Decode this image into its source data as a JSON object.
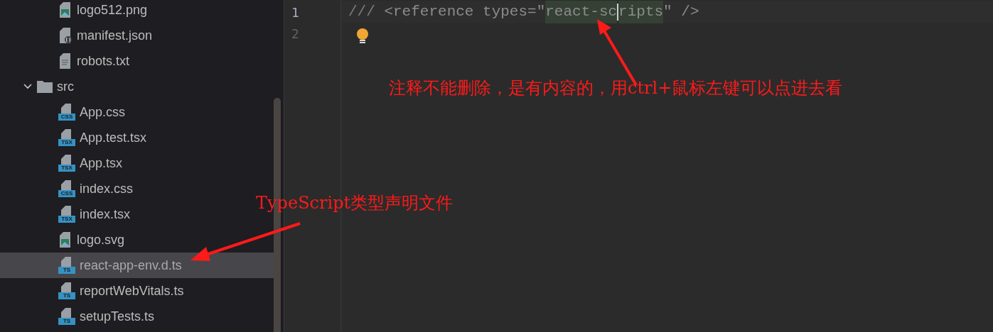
{
  "tree": [
    {
      "children": [
        {
          "kind": "image",
          "label": "logo512.png",
          "selected": false
        },
        {
          "kind": "json",
          "label": "manifest.json",
          "selected": false
        },
        {
          "kind": "text",
          "label": "robots.txt",
          "selected": false
        }
      ]
    },
    {
      "kind": "folder",
      "label": "src",
      "expanded": true,
      "selected": false,
      "children": [
        {
          "kind": "badge",
          "badge": "CSS",
          "label": "App.css",
          "selected": false
        },
        {
          "kind": "badge",
          "badge": "TSX",
          "label": "App.test.tsx",
          "selected": false
        },
        {
          "kind": "badge",
          "badge": "TSX",
          "label": "App.tsx",
          "selected": false
        },
        {
          "kind": "badge",
          "badge": "CSS",
          "label": "index.css",
          "selected": false
        },
        {
          "kind": "badge",
          "badge": "TSX",
          "label": "index.tsx",
          "selected": false
        },
        {
          "kind": "image",
          "label": "logo.svg",
          "selected": false
        },
        {
          "kind": "badge",
          "badge": "TS",
          "label": "react-app-env.d.ts",
          "selected": true
        },
        {
          "kind": "badge",
          "badge": "TS",
          "label": "reportWebVitals.ts",
          "selected": false
        },
        {
          "kind": "badge",
          "badge": "TS",
          "label": "setupTests.ts",
          "selected": false
        }
      ]
    }
  ],
  "editor": {
    "lines": [
      {
        "number": "1",
        "current": true,
        "tokens": [
          {
            "kind": "comment",
            "text": "///"
          },
          {
            "kind": "plain",
            "text": " <reference types=\""
          },
          {
            "kind": "match",
            "text": "react-sc"
          },
          {
            "kind": "caret"
          },
          {
            "kind": "match",
            "text": "ripts"
          },
          {
            "kind": "plain",
            "text": "\" />"
          }
        ]
      },
      {
        "number": "2",
        "current": false,
        "bulb": true
      }
    ]
  },
  "annotations": [
    {
      "kind": "code-note",
      "text": "注释不能删除，是有内容的，用ctrl+鼠标左键可以点进去看"
    },
    {
      "kind": "file-note",
      "text": "TypeScript类型声明文件"
    }
  ]
}
